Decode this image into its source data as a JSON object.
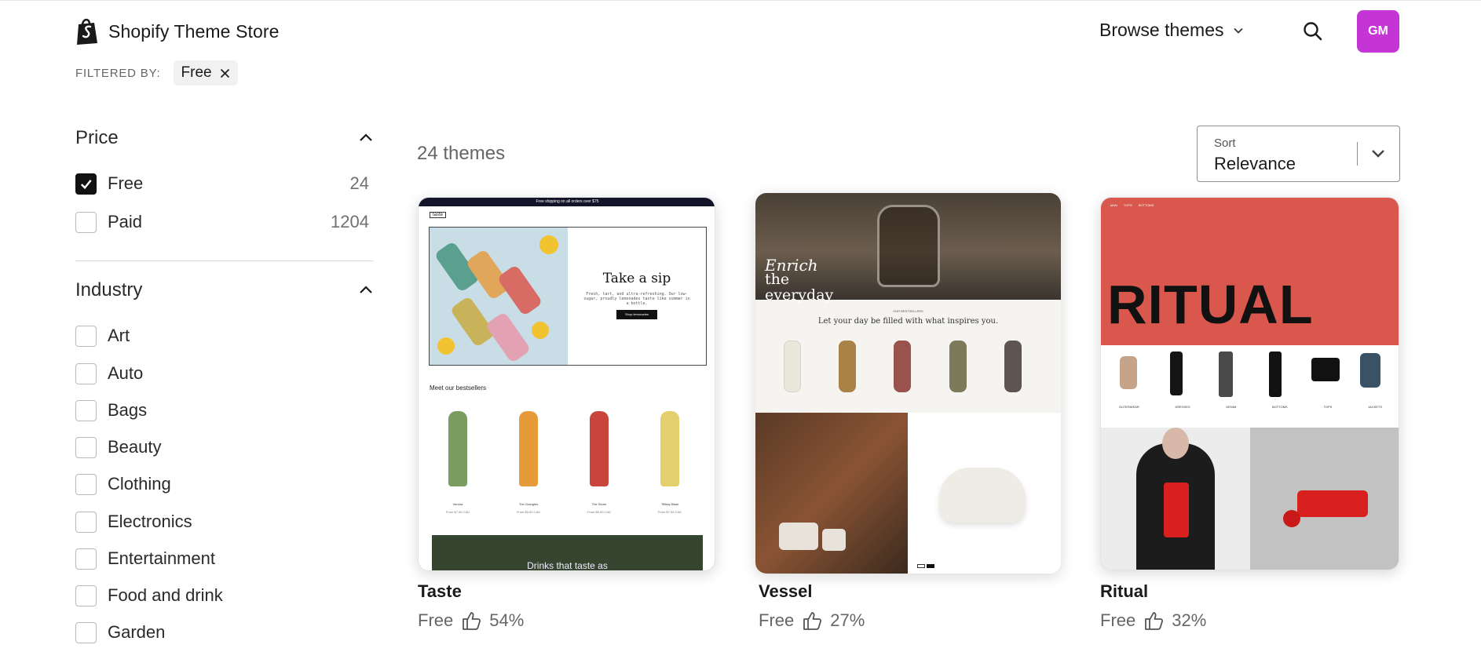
{
  "header": {
    "brand": "Shopify Theme Store",
    "browse_label": "Browse themes",
    "avatar_initials": "GM"
  },
  "filters": {
    "label": "FILTERED BY:",
    "chips": [
      "Free"
    ]
  },
  "sidebar": {
    "price": {
      "title": "Price",
      "options": [
        {
          "label": "Free",
          "count": "24",
          "checked": true
        },
        {
          "label": "Paid",
          "count": "1204",
          "checked": false
        }
      ]
    },
    "industry": {
      "title": "Industry",
      "options": [
        "Art",
        "Auto",
        "Bags",
        "Beauty",
        "Clothing",
        "Electronics",
        "Entertainment",
        "Food and drink",
        "Garden"
      ]
    }
  },
  "results": {
    "count_label": "24 themes",
    "sort": {
      "caption": "Sort",
      "value": "Relevance"
    }
  },
  "themes": [
    {
      "name": "Taste",
      "price": "Free",
      "rating": "54%",
      "preview": {
        "banner": "Free shipping on all orders over $75",
        "brand": "taste",
        "hero_title": "Take a sip",
        "hero_body": "Fresh, tart, and ultra-refreshing. Our low-sugar, proudly lemonades taste like summer in a bottle.",
        "hero_button": "Shop lemonades",
        "section_title": "Meet our bestsellers",
        "products": [
          {
            "name": "Verona",
            "price": "From $7.00 CAD"
          },
          {
            "name": "The Orangies",
            "price": "From $5.00 CAD"
          },
          {
            "name": "The Stone",
            "price": "From $6.50 CAD"
          },
          {
            "name": "Tiffany Blast",
            "price": "From $7.00 CAD"
          }
        ],
        "footer_caption": "Drinks that taste as"
      }
    },
    {
      "name": "Vessel",
      "price": "Free",
      "rating": "27%",
      "preview": {
        "hero_title_italic": "Enrich",
        "hero_title_rest": "the everyday",
        "section_eyebrow": "OUR BESTSELLERS",
        "section_title": "Let your day be filled with what inspires you."
      }
    },
    {
      "name": "Ritual",
      "price": "Free",
      "rating": "32%",
      "preview": {
        "nav": [
          "MAN",
          "TOPS",
          "BOTTOMS"
        ],
        "hero_title": "RITUAL",
        "categories": [
          "OUTERWEAR",
          "DRESSES",
          "DENIM",
          "BOTTOMS",
          "TOPS",
          "JACKETS"
        ]
      }
    }
  ],
  "colors": {
    "avatar": "#c535d6",
    "ritual_hero": "#d9574c",
    "checkbox_checked": "#111111"
  }
}
